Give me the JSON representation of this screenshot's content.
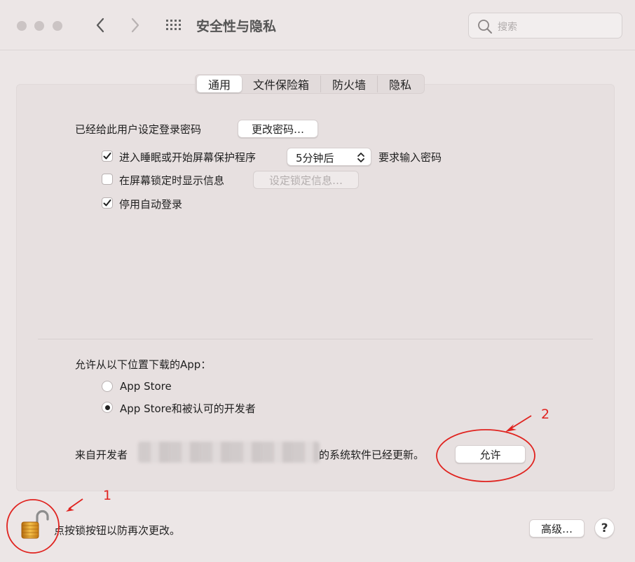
{
  "window": {
    "title": "安全性与隐私",
    "search_placeholder": "搜索"
  },
  "icons": [
    "back-chevron-icon",
    "forward-chevron-icon",
    "grid-icon",
    "search-icon",
    "checkmark-icon",
    "lock-icon",
    "arrow-icon"
  ],
  "tabs": [
    {
      "label": "通用",
      "active": true
    },
    {
      "label": "文件保险箱",
      "active": false
    },
    {
      "label": "防火墙",
      "active": false
    },
    {
      "label": "隐私",
      "active": false
    }
  ],
  "general": {
    "password_set_label": "已经给此用户设定登录密码",
    "change_password_button": "更改密码…",
    "require_password": {
      "checked": true,
      "label": "进入睡眠或开始屏幕保护程序",
      "delay_value": "5分钟后",
      "suffix": "要求输入密码"
    },
    "show_message": {
      "checked": false,
      "label": "在屏幕锁定时显示信息",
      "button": "设定锁定信息…"
    },
    "disable_autologin": {
      "checked": true,
      "label": "停用自动登录"
    }
  },
  "downloads": {
    "heading": "允许从以下位置下载的App：",
    "options": [
      {
        "label": "App Store",
        "selected": false
      },
      {
        "label": "App Store和被认可的开发者",
        "selected": true
      }
    ],
    "blocked_prefix": "来自开发者",
    "blocked_suffix": "的系统软件已经更新。",
    "allow_button": "允许"
  },
  "footer": {
    "lock_text": "点按锁按钮以防再次更改。",
    "advanced_button": "高级…",
    "help_button": "?"
  },
  "annotations": {
    "label_1": "1",
    "label_2": "2",
    "color": "#e0231f"
  }
}
